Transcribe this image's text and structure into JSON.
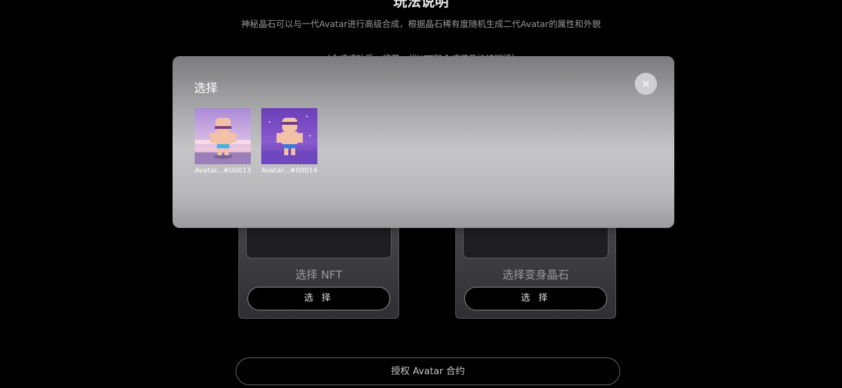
{
  "page": {
    "title": "玩法说明",
    "description": "神秘晶石可以与一代Avatar进行高级合成，根据晶石稀有度随机生成二代Avatar的属性和外貌",
    "hint": "（合成成功后，将获一代NFT和合成道具均被销毁）"
  },
  "slots": [
    {
      "title": "选择 NFT",
      "button": "选 择"
    },
    {
      "title": "选择变身晶石",
      "button": "选 择"
    }
  ],
  "auth_button": "授权 Avatar 合约",
  "modal": {
    "title": "选择",
    "close_glyph": "×",
    "items": [
      {
        "label": "Avatar...#00013"
      },
      {
        "label": "Avatar...#00014"
      }
    ]
  },
  "colors": {
    "background": "#000000",
    "modal_top": "#7b7b7e",
    "modal_mid": "#c5c4c6",
    "slot_bg": "#3a3a3e",
    "thumb1_sky": "#a98ad6",
    "thumb2_sky": "#7f4ec9"
  }
}
